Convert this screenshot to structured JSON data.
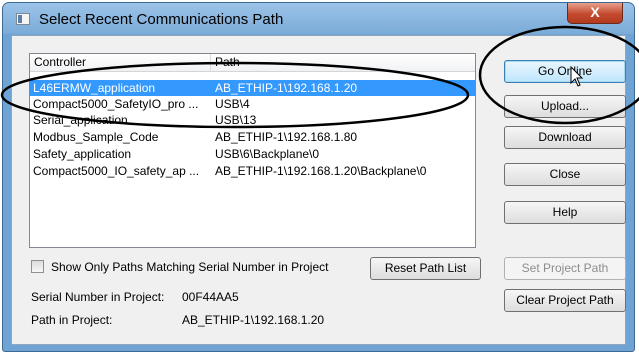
{
  "window": {
    "title": "Select Recent Communications Path",
    "close_glyph": "X"
  },
  "list": {
    "columns": [
      "Controller",
      "Path"
    ],
    "rows": [
      {
        "controller": "L46ERMW_application",
        "path": "AB_ETHIP-1\\192.168.1.20",
        "selected": true
      },
      {
        "controller": "Compact5000_SafetyIO_pro ...",
        "path": "USB\\4",
        "selected": false
      },
      {
        "controller": "Serial_application",
        "path": "USB\\13",
        "selected": false
      },
      {
        "controller": "Modbus_Sample_Code",
        "path": "AB_ETHIP-1\\192.168.1.80",
        "selected": false
      },
      {
        "controller": "Safety_application",
        "path": "USB\\6\\Backplane\\0",
        "selected": false
      },
      {
        "controller": "Compact5000_IO_safety_ap ...",
        "path": "AB_ETHIP-1\\192.168.1.20\\Backplane\\0",
        "selected": false
      }
    ]
  },
  "buttons": {
    "go_online": "Go Online",
    "upload": "Upload...",
    "download": "Download",
    "close": "Close",
    "help": "Help",
    "reset_path_list": "Reset Path List",
    "set_project_path": "Set Project Path",
    "clear_project_path": "Clear Project Path"
  },
  "checkbox": {
    "label": "Show Only Paths Matching Serial Number in Project",
    "checked": false
  },
  "info": {
    "serial_label": "Serial Number in Project:",
    "serial_value": "00F44AA5",
    "path_label": "Path in Project:",
    "path_value": "AB_ETHIP-1\\192.168.1.20"
  },
  "colors": {
    "selection": "#3399ff",
    "annotation": "#000000"
  }
}
